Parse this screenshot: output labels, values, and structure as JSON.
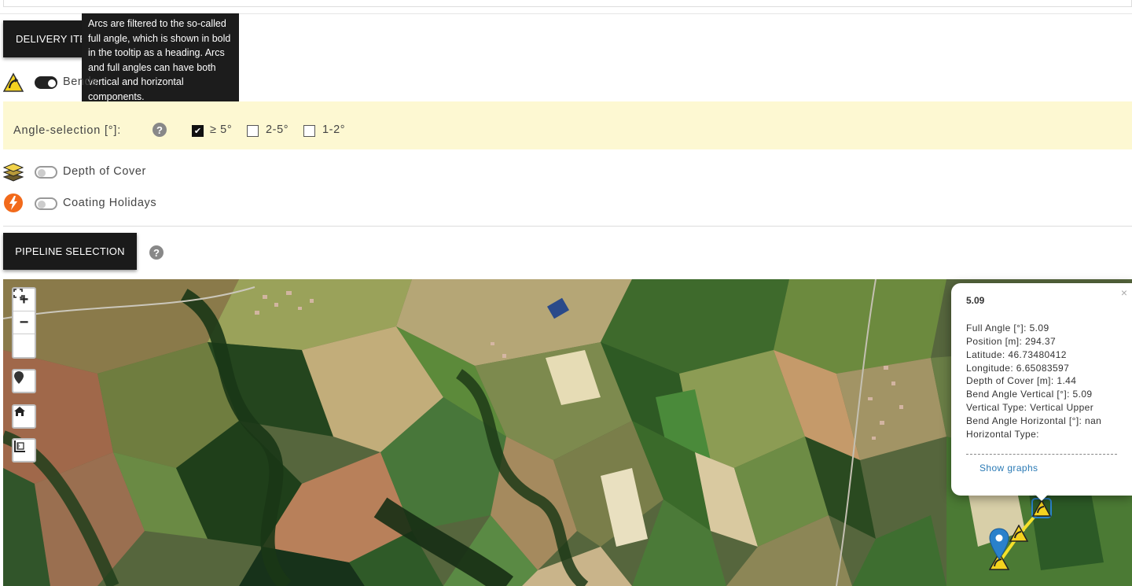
{
  "header": {
    "delivery_button": "DELIVERY ITEMS",
    "pipeline_button": "PIPELINE SELECTION"
  },
  "tooltip": {
    "text": "Arcs are filtered to the so-called full angle, which is shown in bold in the tooltip as a heading. Arcs and full angles can have both vertical and horizontal components."
  },
  "layers": [
    {
      "label": "Bends",
      "icon": "bend-warning-icon",
      "enabled": true
    },
    {
      "label": "Depth of Cover",
      "icon": "layers-icon",
      "enabled": false
    },
    {
      "label": "Coating Holidays",
      "icon": "lightning-icon",
      "enabled": false
    }
  ],
  "angle_selection": {
    "title": "Angle-selection [°]:",
    "options": [
      {
        "label": "≥ 5°",
        "checked": true
      },
      {
        "label": "2-5°",
        "checked": false
      },
      {
        "label": "1-2°",
        "checked": false
      }
    ]
  },
  "map_controls": {
    "zoom_in": "+",
    "zoom_out": "−",
    "fullscreen_icon": "fullscreen-icon",
    "marker_icon": "map-marker-icon",
    "home_icon": "home-icon",
    "measure_icon": "ruler-icon"
  },
  "popup": {
    "title": "5.09",
    "close": "×",
    "lines": [
      "Full Angle [°]: 5.09",
      "Position [m]: 294.37",
      "Latitude: 46.73480412",
      "Longitude: 6.65083597",
      "Depth of Cover [m]: 1.44",
      "Bend Angle Vertical [°]: 5.09",
      "Vertical Type: Vertical Upper",
      "Bend Angle Horizontal [°]: nan",
      "Horizontal Type:"
    ],
    "link": "Show graphs"
  },
  "colors": {
    "dark": "#1a1a1a",
    "angle_panel_bg": "#fdf8d2",
    "pipeline": "#f5e12a",
    "marker": "#2a81cb",
    "link": "#2a7ab5"
  }
}
